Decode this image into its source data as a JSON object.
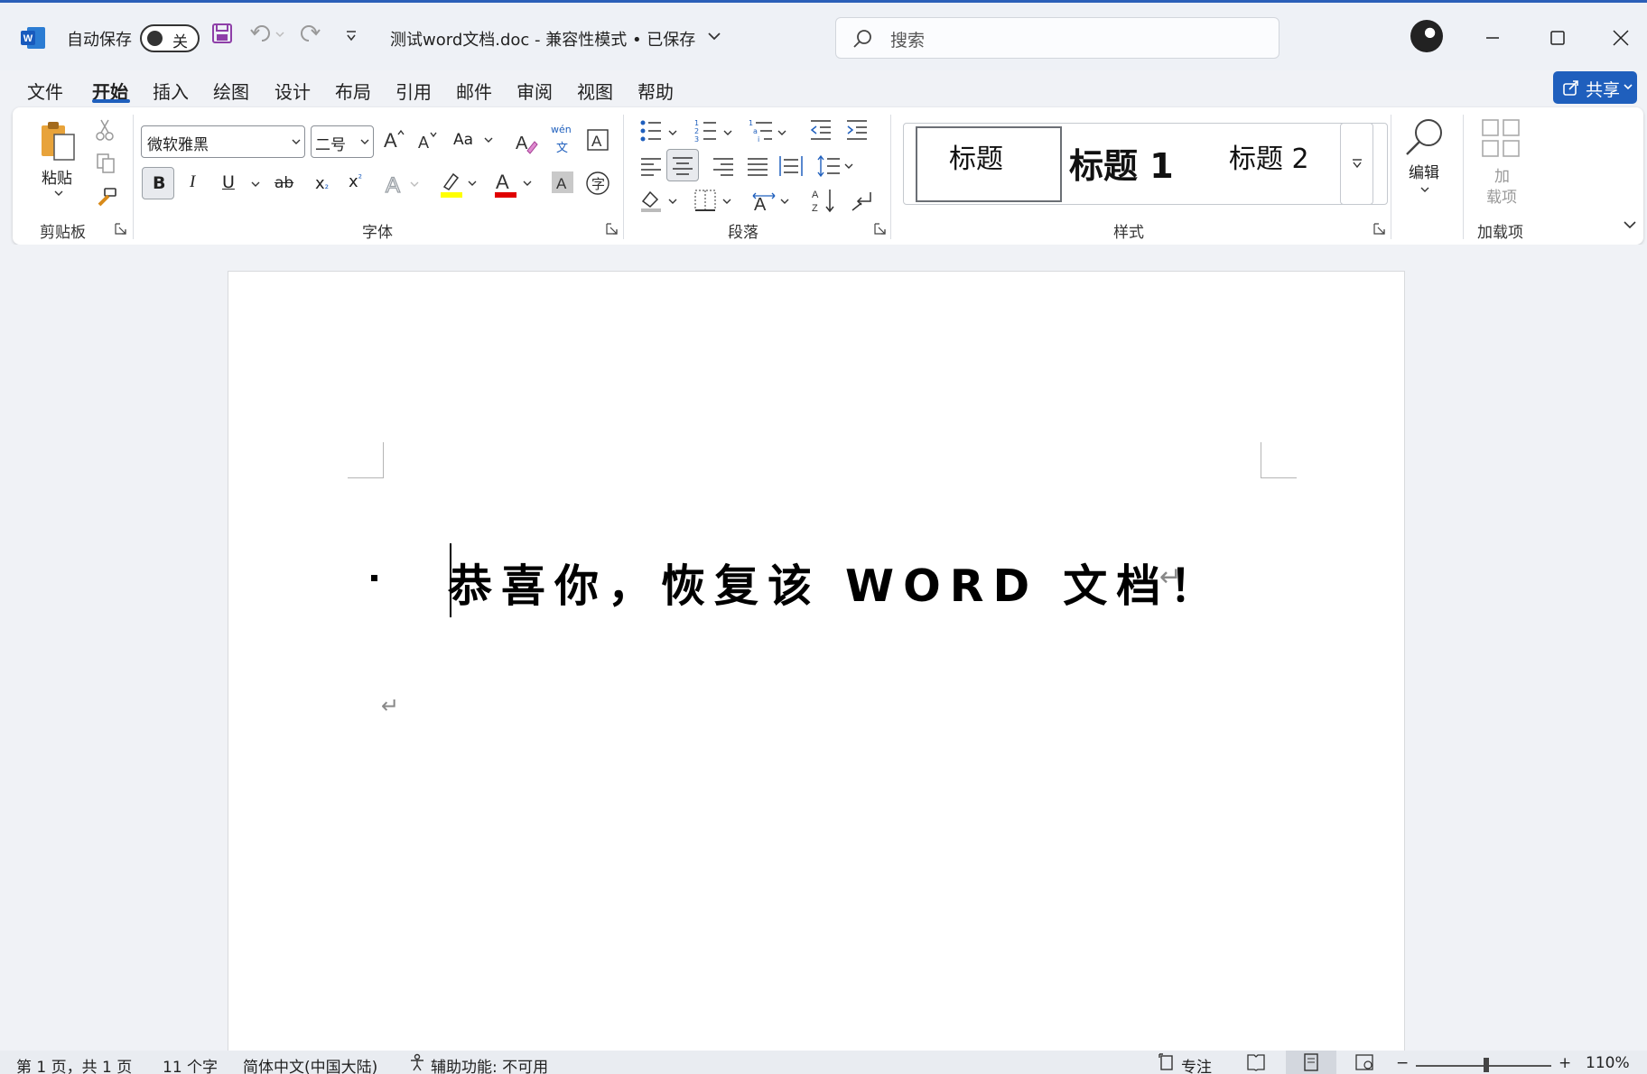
{
  "titlebar": {
    "autosave_label": "自动保存",
    "autosave_state": "关",
    "doc_title": "测试word文档.doc  -  兼容性模式 • 已保存",
    "search_placeholder": "搜索"
  },
  "menu": {
    "tabs": [
      "文件",
      "开始",
      "插入",
      "绘图",
      "设计",
      "布局",
      "引用",
      "邮件",
      "审阅",
      "视图",
      "帮助"
    ],
    "active": "开始",
    "share_label": "共享"
  },
  "ribbon": {
    "clipboard": {
      "paste_label": "粘贴",
      "group_label": "剪贴板"
    },
    "font": {
      "font_name": "微软雅黑",
      "font_size": "二号",
      "case_label": "Aa",
      "group_label": "字体",
      "pinyin_top": "wén",
      "pinyin_char": "文",
      "bold": "B",
      "italic": "I",
      "underline": "U",
      "strike": "ab",
      "sub": "x",
      "sup": "x",
      "char_shading": "A",
      "enclose": "字"
    },
    "paragraph": {
      "group_label": "段落"
    },
    "styles": {
      "items": [
        "标题",
        "标题 1",
        "标题 2"
      ],
      "group_label": "样式"
    },
    "editing": {
      "label": "编辑"
    },
    "addins": {
      "label_line1": "加",
      "label_line2": "载项",
      "group_label": "加载项"
    }
  },
  "document": {
    "heading": "恭喜你，恢复该 WORD 文档！"
  },
  "status": {
    "page": "第 1 页，共 1 页",
    "words": "11 个字",
    "language": "简体中文(中国大陆)",
    "accessibility": "辅助功能: 不可用",
    "focus": "专注",
    "zoom": "110%"
  },
  "colors": {
    "accent": "#1f5fbd",
    "highlight": "#ffff00",
    "font_color": "#e00000"
  }
}
